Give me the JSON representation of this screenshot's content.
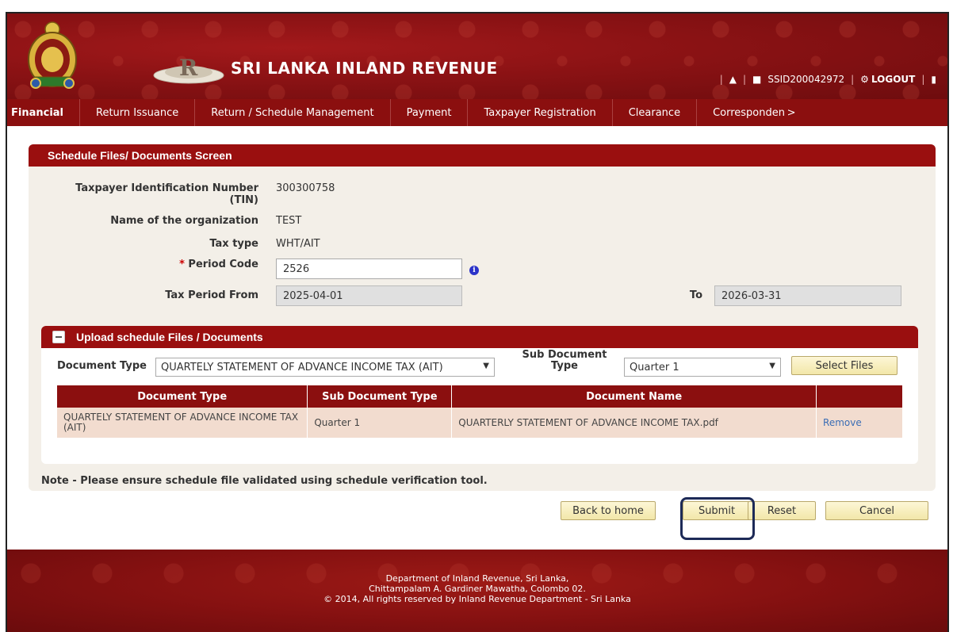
{
  "header": {
    "title": "SRI LANKA INLAND REVENUE",
    "user_id": "SSID200042972",
    "logout_label": "LOGOUT"
  },
  "menu": [
    "Financial",
    "Return Issuance",
    "Return / Schedule Management",
    "Payment",
    "Taxpayer Registration",
    "Clearance",
    "Corresponden >"
  ],
  "panel": {
    "title": "Schedule Files/ Documents Screen",
    "tin_label": "Taxpayer Identification Number",
    "tin_label2": "(TIN)",
    "tin_value": "300300758",
    "org_label": "Name of the organization",
    "org_value": "TEST",
    "taxtype_label": "Tax type",
    "taxtype_value": "WHT/AIT",
    "period_required_mark": "*",
    "period_label": "Period Code",
    "period_value": "2526",
    "from_label": "Tax Period From",
    "from_value": "2025-04-01",
    "to_label": "To",
    "to_value": "2026-03-31"
  },
  "upload": {
    "title": "Upload schedule Files / Documents",
    "doc_type_label": "Document Type",
    "doc_type_value": "QUARTELY STATEMENT OF ADVANCE INCOME TAX (AIT)",
    "sub_doc_label1": "Sub Document",
    "sub_doc_label2": "Type",
    "sub_doc_value": "Quarter 1",
    "select_files_label": "Select Files",
    "columns": [
      "Document Type",
      "Sub Document Type",
      "Document Name",
      ""
    ],
    "rows": [
      {
        "doc_type": "QUARTELY STATEMENT OF ADVANCE INCOME TAX (AIT)",
        "sub_type": "Quarter 1",
        "doc_name": "QUARTERLY STATEMENT OF ADVANCE INCOME TAX.pdf",
        "action": "Remove"
      }
    ]
  },
  "note": "Note - Please ensure schedule file validated using schedule verification tool.",
  "actions": {
    "back_label": "Back to home",
    "submit_label": "Submit",
    "reset_label": "Reset",
    "cancel_label": "Cancel"
  },
  "footer": {
    "line1": "Department of Inland Revenue, Sri Lanka,",
    "line2": "Chittampalam A. Gardiner Mawatha, Colombo 02.",
    "line3": "© 2014, All rights reserved by Inland Revenue Department - Sri Lanka"
  }
}
